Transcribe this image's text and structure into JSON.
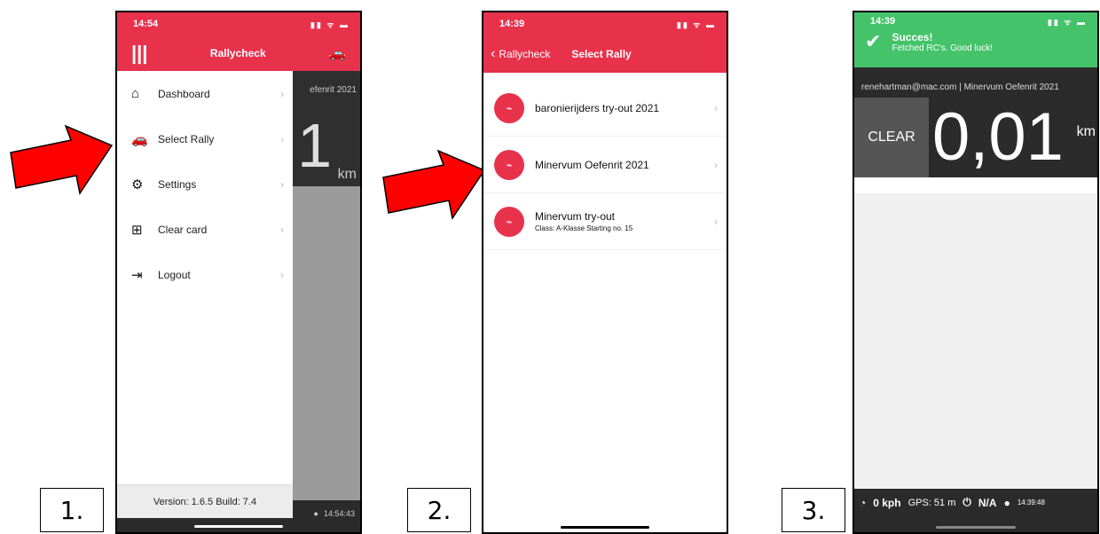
{
  "phone1": {
    "time": "14:54",
    "signal": "▮▮ ᯤ ▬",
    "app_title": "Rallycheck",
    "menu": [
      {
        "icon": "home-icon",
        "glyph": "⌂",
        "label": "Dashboard"
      },
      {
        "icon": "car-icon",
        "glyph": "🚗",
        "label": "Select Rally"
      },
      {
        "icon": "gears-icon",
        "glyph": "⚙",
        "label": "Settings"
      },
      {
        "icon": "grid-icon",
        "glyph": "⊞",
        "label": "Clear card"
      },
      {
        "icon": "logout-icon",
        "glyph": "⇥",
        "label": "Logout"
      }
    ],
    "chevron": "›",
    "version": "Version: 1.6.5 Build: 7.4",
    "bg_header": "efenrit 2021",
    "bg_counter": "1",
    "bg_unit": "km",
    "bg_time": "14:54:43"
  },
  "phone2": {
    "time": "14:39",
    "back_label": "Rallycheck",
    "title": "Select Rally",
    "rallies": [
      {
        "name": "baronierijders try-out 2021",
        "sub": ""
      },
      {
        "name": "Minervum Oefenrit 2021",
        "sub": ""
      },
      {
        "name": "Minervum try-out",
        "sub": "Class: A-Klasse Starting no. 15"
      }
    ],
    "chevron": "›"
  },
  "phone3": {
    "time": "14:39",
    "success_title": "Succes!",
    "success_message": "Fetched RC's. Good luck!",
    "info_line": "renehartman@mac.com | Minervum Oefenrit 2021",
    "clear_label": "CLEAR",
    "counter": "0,01",
    "unit": "km",
    "speed": "0 kph",
    "gps": "GPS: 51 m",
    "na": "N/A",
    "clock": "14:39:48"
  },
  "labels": [
    "1.",
    "2.",
    "3."
  ],
  "colors": {
    "accent_red": "#e8324c",
    "success_green": "#45c36a",
    "arrow_red": "#ff0000"
  }
}
